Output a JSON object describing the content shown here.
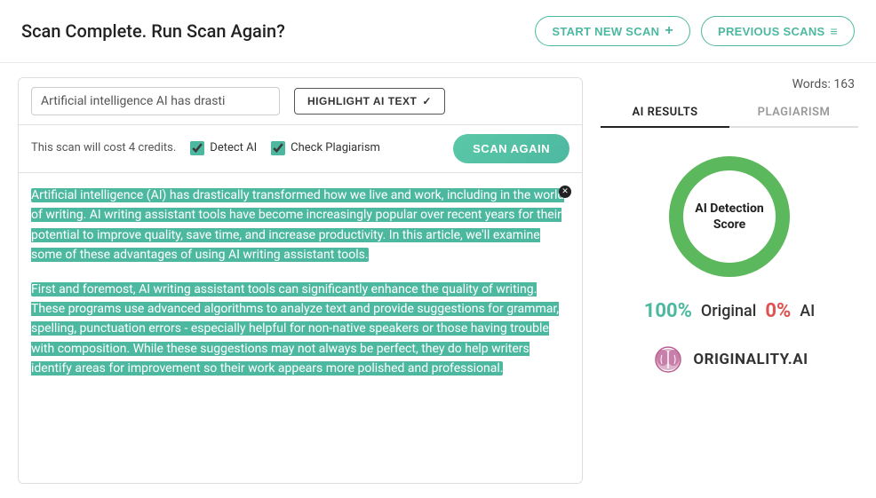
{
  "header": {
    "title": "Scan Complete. Run Scan Again?",
    "start_new_scan": "START NEW SCAN",
    "previous_scans": "PREVIOUS SCANS"
  },
  "toolbar": {
    "text_preview": "Artificial intelligence AI has drasti",
    "highlight_btn": "HIGHLIGHT AI TEXT",
    "highlight_check": "✓"
  },
  "scan_options": {
    "cost_text": "This scan will cost 4 credits.",
    "detect_ai_label": "Detect AI",
    "check_plagiarism_label": "Check Plagiarism",
    "scan_again_btn": "SCAN AGAIN"
  },
  "text_content": {
    "paragraph1": "Artificial intelligence (AI) has drastically transformed how we live and work, including in the world of writing. AI writing assistant tools have become increasingly popular over recent years for their potential to improve quality, save time, and increase productivity. In this article, we'll examine some of these advantages of using AI writing assistant tools.",
    "paragraph2": "First and foremost, AI writing assistant tools can significantly enhance the quality of writing. These programs use advanced algorithms to analyze text and provide suggestions for grammar, spelling, punctuation errors - especially helpful for non-native speakers or those having trouble with composition. While these suggestions may not always be perfect, they do help writers identify areas for improvement so their work appears more polished and professional."
  },
  "right_panel": {
    "words_label": "Words: 163",
    "tab_ai": "AI RESULTS",
    "tab_plagiarism": "PLAGIARISM",
    "donut_label_line1": "AI Detection",
    "donut_label_line2": "Score",
    "score_original_pct": "100%",
    "score_original_label": "Original",
    "score_ai_pct": "0%",
    "score_ai_label": "AI",
    "brand_name": "ORIGINALITY.AI",
    "donut_color": "#5cb85c",
    "donut_bg_color": "#e8e8e8"
  }
}
